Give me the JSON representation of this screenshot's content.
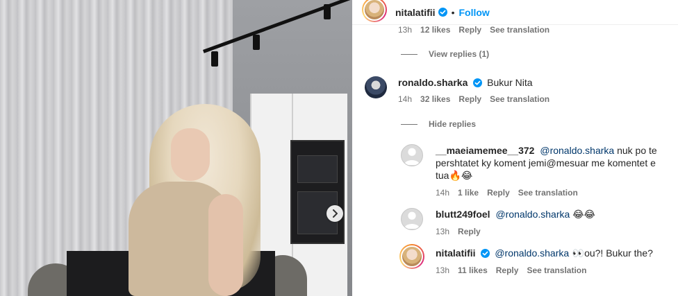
{
  "post": {
    "author": "nitalatifii",
    "follow_label": "Follow",
    "dot": "•"
  },
  "photo": {
    "next_icon": "chevron-right-icon"
  },
  "comments": {
    "top_meta": {
      "time": "13h",
      "likes": "12 likes",
      "reply": "Reply",
      "translate": "See translation"
    },
    "view_replies": "View replies (1)",
    "main": {
      "username": "ronaldo.sharka",
      "text": "Bukur Nita",
      "time": "14h",
      "likes": "32 likes",
      "reply": "Reply",
      "translate": "See translation"
    },
    "hide_replies": "Hide replies",
    "replies": [
      {
        "username": "__maeiamemee__372",
        "mention": "@ronaldo.sharka",
        "text": " nuk po te pershtatet ky koment jemi@mesuar me komentet e tua",
        "emoji": "🔥😂",
        "time": "14h",
        "likes": "1 like",
        "reply": "Reply",
        "translate": "See translation"
      },
      {
        "username": "blutt249foel",
        "mention": "@ronaldo.sharka",
        "text": " ",
        "emoji": "😂😂",
        "time": "13h",
        "reply": "Reply"
      },
      {
        "username": "nitalatifii",
        "mention": "@ronaldo.sharka",
        "emoji": " 👀",
        "text": "ou?! Bukur the?",
        "time": "13h",
        "likes": "11 likes",
        "reply": "Reply",
        "translate": "See translation"
      }
    ]
  },
  "colors": {
    "link_blue": "#0095f6",
    "mention_blue": "#00376b",
    "secondary_text": "#737373",
    "verified_blue": "#0095f6"
  }
}
